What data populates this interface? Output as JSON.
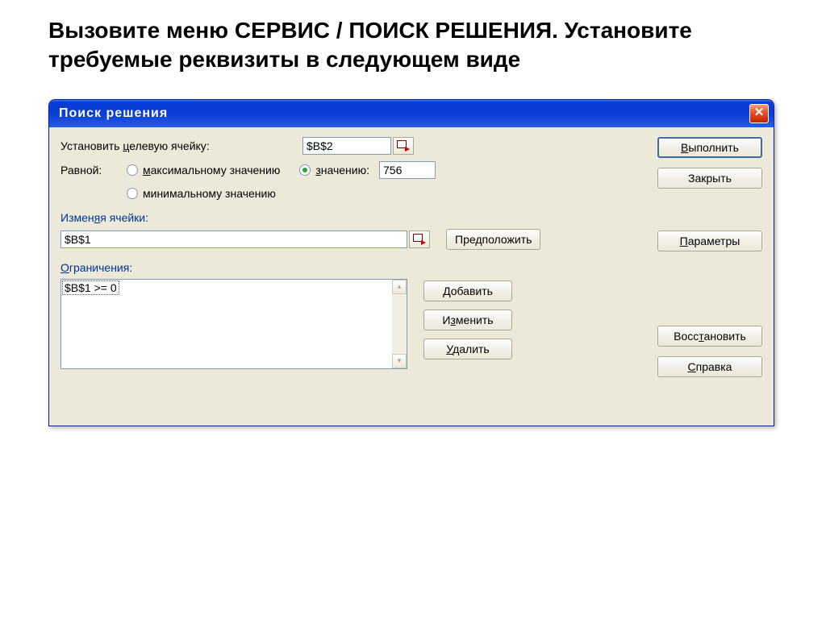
{
  "heading": "Вызовите меню СЕРВИС / ПОИСК РЕШЕНИЯ. Установите требуемые реквизиты в следующем виде",
  "dialog": {
    "title": "Поиск решения",
    "close_x": "✕",
    "target_label_pre": "Установить ",
    "target_label_u": "ц",
    "target_label_post": "елевую ячейку:",
    "target_value": "$B$2",
    "equal_label": "Равной:",
    "radio_max_u": "м",
    "radio_max_post": "аксимальному значению",
    "radio_value_u": "з",
    "radio_value_post": "начению:",
    "value_input": "756",
    "radio_min_post": "минимальному значению",
    "changing_label_pre": "Измен",
    "changing_label_u": "я",
    "changing_label_post": "я ячейки:",
    "changing_value": "$B$1",
    "suggest_btn": "Предположить",
    "constraints_label_u": "О",
    "constraints_label_post": "граничения:",
    "constraint_item": "$B$1 >= 0",
    "add_btn_u": "Д",
    "add_btn_post": "обавить",
    "edit_btn_pre": "И",
    "edit_btn_u": "з",
    "edit_btn_post": "менить",
    "del_btn_u": "У",
    "del_btn_post": "далить",
    "execute_btn_u": "В",
    "execute_btn_post": "ыполнить",
    "close_btn": "Закрыть",
    "params_btn_u": "П",
    "params_btn_post": "араметры",
    "restore_btn_pre": "Восс",
    "restore_btn_u": "т",
    "restore_btn_post": "ановить",
    "help_btn_u": "С",
    "help_btn_post": "правка"
  }
}
